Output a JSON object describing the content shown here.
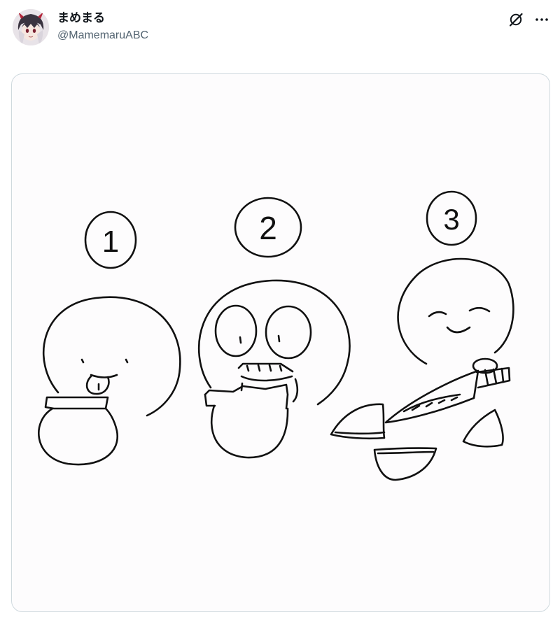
{
  "post": {
    "author": {
      "display_name": "まめまる",
      "handle": "@MamemaruABC"
    },
    "actions": {
      "grok_icon": "grok-icon",
      "more_icon": "more-icon"
    },
    "media": {
      "panel_numbers": [
        "1",
        "2",
        "3"
      ]
    }
  },
  "colors": {
    "text_primary": "#0f1419",
    "text_secondary": "#536471",
    "border": "#cfd9de",
    "ink": "#111111"
  }
}
